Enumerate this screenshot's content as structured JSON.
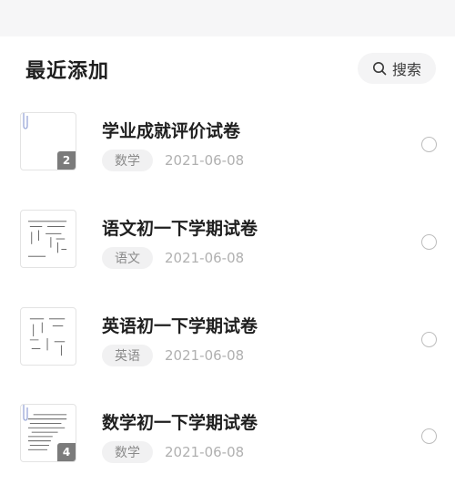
{
  "section": {
    "title": "最近添加"
  },
  "search": {
    "label": "搜索",
    "icon": "search-icon"
  },
  "colors": {
    "badge_bg": "#7b7b7b",
    "tag_bg": "#f1f1f2",
    "date_text": "#b0b0b0"
  },
  "items": [
    {
      "title": "学业成就评价试卷",
      "subject": "数学",
      "date": "2021-06-08",
      "page_count": "2"
    },
    {
      "title": "语文初一下学期试卷",
      "subject": "语文",
      "date": "2021-06-08",
      "page_count": ""
    },
    {
      "title": "英语初一下学期试卷",
      "subject": "英语",
      "date": "2021-06-08",
      "page_count": ""
    },
    {
      "title": "数学初一下学期试卷",
      "subject": "数学",
      "date": "2021-06-08",
      "page_count": "4"
    }
  ]
}
